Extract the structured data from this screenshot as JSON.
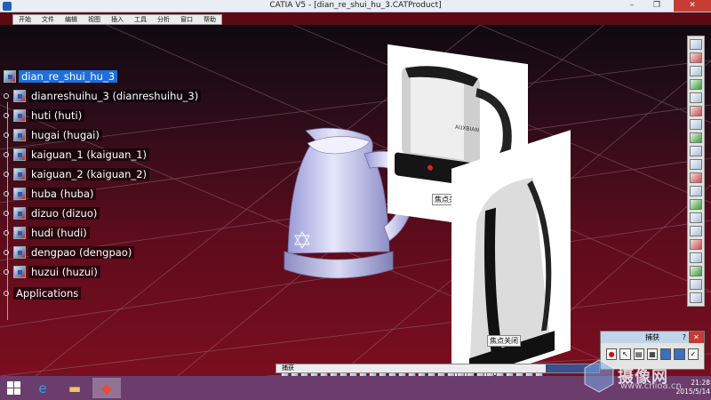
{
  "window": {
    "title": "CATIA V5 - [dian_re_shui_hu_3.CATProduct]",
    "minimize": "–",
    "maximize": "❐",
    "close": "✕"
  },
  "menu": [
    "开始",
    "文件",
    "编辑",
    "视图",
    "插入",
    "工具",
    "分析",
    "窗口",
    "帮助"
  ],
  "tree": {
    "root": "dian_re_shui_hu_3",
    "nodes": [
      "dianreshuihu_3 (dianreshuihu_3)",
      "huti (huti)",
      "hugai (hugai)",
      "kaiguan_1 (kaiguan_1)",
      "kaiguan_2 (kaiguan_2)",
      "huba (huba)",
      "dizuo (dizuo)",
      "hudi (hudi)",
      "dengpao (dengpao)",
      "huzui (huzui)"
    ],
    "footer": "Applications"
  },
  "viewport": {
    "photo1_label": "焦点关闭",
    "photo2_label": "焦点关闭",
    "photo1_brand": "AUXBIAN"
  },
  "status_bar": {
    "prompt": "捕获"
  },
  "capture_panel": {
    "title": "捕获",
    "help": "?",
    "close": "✕"
  },
  "taskbar": {
    "time": "21:28",
    "date": "2015/5/14"
  },
  "watermark": {
    "main": "摄像网",
    "sub": "www.chioa.cn"
  },
  "colors": {
    "viewport_bottom": "#7a0e1f",
    "selection": "#1e6fd9",
    "taskbar": "#6a3d6c",
    "close_red": "#c43c32"
  }
}
